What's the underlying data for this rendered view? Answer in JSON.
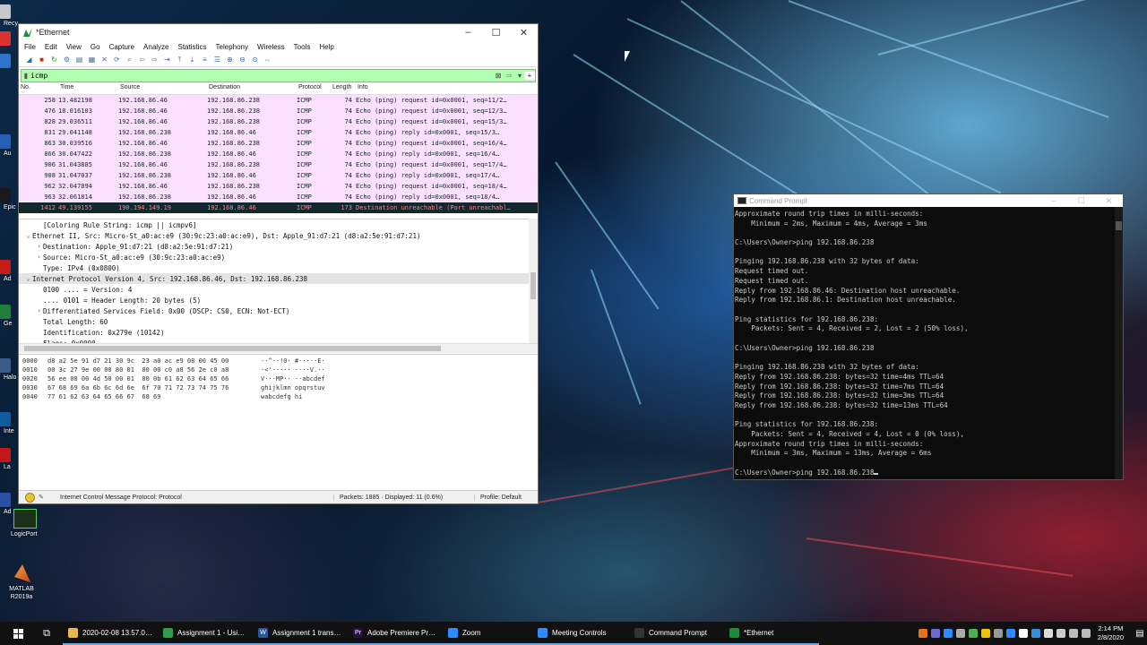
{
  "desktop": {
    "icons": [
      {
        "label": "Recy",
        "color": "#c9c9c9"
      },
      {
        "label": "",
        "color": "#dd3030"
      },
      {
        "label": "",
        "color": "#2f74c9"
      },
      {
        "label": "Au",
        "color": "#2460b8"
      },
      {
        "label": "Epic",
        "color": "#1a1a1a"
      },
      {
        "label": "Ad",
        "color": "#c71a1a"
      },
      {
        "label": "Ge",
        "color": "#1e7e3a"
      },
      {
        "label": "Halo",
        "color": "#3a5a8a"
      },
      {
        "label": "Inte",
        "color": "#0f5d9e"
      },
      {
        "label": "La",
        "color": "#c21818"
      },
      {
        "label": "Ad",
        "color": "#2a4fa5"
      }
    ],
    "logicport_label": "LogicPort",
    "matlab_label": "MATLAB R2019a"
  },
  "wireshark": {
    "title": "*Ethernet",
    "menu": [
      "File",
      "Edit",
      "View",
      "Go",
      "Capture",
      "Analyze",
      "Statistics",
      "Telephony",
      "Wireless",
      "Tools",
      "Help"
    ],
    "filter": "icmp",
    "columns": {
      "no": "No.",
      "time": "Time",
      "source": "Source",
      "destination": "Destination",
      "protocol": "Protocol",
      "length": "Length",
      "info": "Info"
    },
    "packets": [
      {
        "no": "258",
        "time": "13.482198",
        "src": "192.168.86.46",
        "dst": "192.168.86.238",
        "proto": "ICMP",
        "len": "74",
        "info": "Echo (ping) request  id=0x0001, seq=11/2…"
      },
      {
        "no": "476",
        "time": "18.016103",
        "src": "192.168.86.46",
        "dst": "192.168.86.238",
        "proto": "ICMP",
        "len": "74",
        "info": "Echo (ping) request  id=0x0001, seq=12/3…"
      },
      {
        "no": "828",
        "time": "29.036511",
        "src": "192.168.86.46",
        "dst": "192.168.86.238",
        "proto": "ICMP",
        "len": "74",
        "info": "Echo (ping) request  id=0x0001, seq=15/3…"
      },
      {
        "no": "831",
        "time": "29.041148",
        "src": "192.168.86.238",
        "dst": "192.168.86.46",
        "proto": "ICMP",
        "len": "74",
        "info": "Echo (ping) reply    id=0x0001, seq=15/3…"
      },
      {
        "no": "863",
        "time": "30.039516",
        "src": "192.168.86.46",
        "dst": "192.168.86.238",
        "proto": "ICMP",
        "len": "74",
        "info": "Echo (ping) request  id=0x0001, seq=16/4…"
      },
      {
        "no": "866",
        "time": "30.047422",
        "src": "192.168.86.238",
        "dst": "192.168.86.46",
        "proto": "ICMP",
        "len": "74",
        "info": "Echo (ping) reply    id=0x0001, seq=16/4…"
      },
      {
        "no": "906",
        "time": "31.043885",
        "src": "192.168.86.46",
        "dst": "192.168.86.238",
        "proto": "ICMP",
        "len": "74",
        "info": "Echo (ping) request  id=0x0001, seq=17/4…"
      },
      {
        "no": "908",
        "time": "31.047037",
        "src": "192.168.86.238",
        "dst": "192.168.86.46",
        "proto": "ICMP",
        "len": "74",
        "info": "Echo (ping) reply    id=0x0001, seq=17/4…"
      },
      {
        "no": "962",
        "time": "32.047894",
        "src": "192.168.86.46",
        "dst": "192.168.86.238",
        "proto": "ICMP",
        "len": "74",
        "info": "Echo (ping) request  id=0x0001, seq=18/4…"
      },
      {
        "no": "963",
        "time": "32.061814",
        "src": "192.168.86.238",
        "dst": "192.168.86.46",
        "proto": "ICMP",
        "len": "74",
        "info": "Echo (ping) reply    id=0x0001, seq=18/4…"
      },
      {
        "no": "1412",
        "time": "49.139155",
        "src": "190.194.149.19",
        "dst": "192.168.86.46",
        "proto": "ICMP",
        "len": "173",
        "info": "Destination unreachable (Port unreachabl…",
        "selected": true
      }
    ],
    "details": [
      {
        "indent": 1,
        "toggle": "",
        "text": "[Coloring Rule String: icmp || icmpv6]"
      },
      {
        "indent": 0,
        "toggle": "v",
        "text": "Ethernet II, Src: Micro-St_a0:ac:e9 (30:9c:23:a0:ac:e9), Dst: Apple_91:d7:21 (d8:a2:5e:91:d7:21)"
      },
      {
        "indent": 1,
        "toggle": ">",
        "text": "Destination: Apple_91:d7:21 (d8:a2:5e:91:d7:21)"
      },
      {
        "indent": 1,
        "toggle": ">",
        "text": "Source: Micro-St_a0:ac:e9 (30:9c:23:a0:ac:e9)"
      },
      {
        "indent": 1,
        "toggle": "",
        "text": "Type: IPv4 (0x0800)"
      },
      {
        "indent": 0,
        "toggle": "v",
        "text": "Internet Protocol Version 4, Src: 192.168.86.46, Dst: 192.168.86.238",
        "hl": true
      },
      {
        "indent": 1,
        "toggle": "",
        "text": "0100 .... = Version: 4"
      },
      {
        "indent": 1,
        "toggle": "",
        "text": ".... 0101 = Header Length: 20 bytes (5)"
      },
      {
        "indent": 1,
        "toggle": ">",
        "text": "Differentiated Services Field: 0x00 (DSCP: CS0, ECN: Not-ECT)"
      },
      {
        "indent": 1,
        "toggle": "",
        "text": "Total Length: 60"
      },
      {
        "indent": 1,
        "toggle": "",
        "text": "Identification: 0x279e (10142)"
      },
      {
        "indent": 1,
        "toggle": "",
        "text": "Flags: 0x0000"
      }
    ],
    "bytes": [
      {
        "off": "0000",
        "hex": "d8 a2 5e 91 d7 21 30 9c  23 a0 ac e9 08 00 45 00",
        "ascii": "··^··!0· #·····E·"
      },
      {
        "off": "0010",
        "hex": "00 3c 27 9e 00 00 80 01  00 00 c0 a8 56 2e c0 a8",
        "ascii": "·<'····· ····V.··"
      },
      {
        "off": "0020",
        "hex": "56 ee 08 00 4d 50 00 01  00 0b 61 62 63 64 65 66",
        "ascii": "V···MP·· ··abcdef"
      },
      {
        "off": "0030",
        "hex": "67 68 69 6a 6b 6c 6d 6e  6f 70 71 72 73 74 75 76",
        "ascii": "ghijklmn opqrstuv"
      },
      {
        "off": "0040",
        "hex": "77 61 62 63 64 65 66 67  68 69",
        "ascii": "wabcdefg hi"
      }
    ],
    "status": {
      "protocol": "Internet Control Message Protocol: Protocol",
      "packets": "Packets: 1885 · Displayed: 11 (0.6%)",
      "profile": "Profile: Default"
    }
  },
  "cmd": {
    "title": "Command Prompt",
    "lines": [
      "Approximate round trip times in milli-seconds:",
      "    Minimum = 2ms, Maximum = 4ms, Average = 3ms",
      "",
      "C:\\Users\\Owner>ping 192.168.86.238",
      "",
      "Pinging 192.168.86.238 with 32 bytes of data:",
      "Request timed out.",
      "Request timed out.",
      "Reply from 192.168.86.46: Destination host unreachable.",
      "Reply from 192.168.86.1: Destination host unreachable.",
      "",
      "Ping statistics for 192.168.86.238:",
      "    Packets: Sent = 4, Received = 2, Lost = 2 (50% loss),",
      "",
      "C:\\Users\\Owner>ping 192.168.86.238",
      "",
      "Pinging 192.168.86.238 with 32 bytes of data:",
      "Reply from 192.168.86.238: bytes=32 time=4ms TTL=64",
      "Reply from 192.168.86.238: bytes=32 time=7ms TTL=64",
      "Reply from 192.168.86.238: bytes=32 time=3ms TTL=64",
      "Reply from 192.168.86.238: bytes=32 time=13ms TTL=64",
      "",
      "Ping statistics for 192.168.86.238:",
      "    Packets: Sent = 4, Received = 4, Lost = 0 (0% loss),",
      "Approximate round trip times in milli-seconds:",
      "    Minimum = 3ms, Maximum = 13ms, Average = 6ms",
      "",
      "C:\\Users\\Owner>ping 192.168.86.238"
    ]
  },
  "taskbar": {
    "tasks": [
      {
        "label": "2020-02-08 13.57.0…",
        "icon_color": "#e8b84a",
        "glyph": ""
      },
      {
        "label": "Assignment 1 - Usi…",
        "icon_color": "#2f9e44",
        "glyph": ""
      },
      {
        "label": "Assignment 1 trans…",
        "icon_color": "#2b579a",
        "glyph": "W"
      },
      {
        "label": "Adobe Premiere Pr…",
        "icon_color": "#2a0f3f",
        "glyph": "Pr"
      },
      {
        "label": "Zoom",
        "icon_color": "#2d8cff",
        "glyph": ""
      },
      {
        "label": "Meeting Controls",
        "icon_color": "#2d8cff",
        "glyph": ""
      },
      {
        "label": "Command Prompt",
        "icon_color": "#333333",
        "glyph": ""
      },
      {
        "label": "*Ethernet",
        "icon_color": "#1d8a3c",
        "glyph": ""
      }
    ],
    "time": "2:14 PM",
    "date": "2/8/2020"
  }
}
